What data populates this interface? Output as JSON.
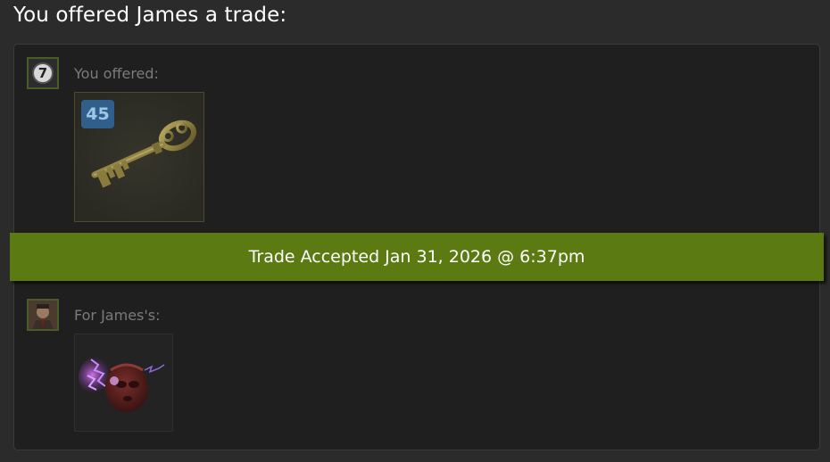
{
  "header": {
    "title": "You offered James a trade:"
  },
  "my_offer": {
    "avatar_icon": "seven-badge-icon",
    "avatar_text": "7",
    "label": "You offered:",
    "items": [
      {
        "name_icon": "mann-co-key-icon",
        "quantity": "45"
      }
    ]
  },
  "status": {
    "text": "Trade Accepted Jan 31, 2026 @ 6:37pm",
    "color": "#5b7a12"
  },
  "their_offer": {
    "avatar_icon": "james-avatar-icon",
    "label": "For James's:",
    "items": [
      {
        "name_icon": "spy-mask-unusual-icon"
      }
    ]
  },
  "colors": {
    "background": "#2b2b2b",
    "panel": "#1f1f1f",
    "label": "#7b7b7b",
    "quantity_badge": "#2f5f8a"
  }
}
